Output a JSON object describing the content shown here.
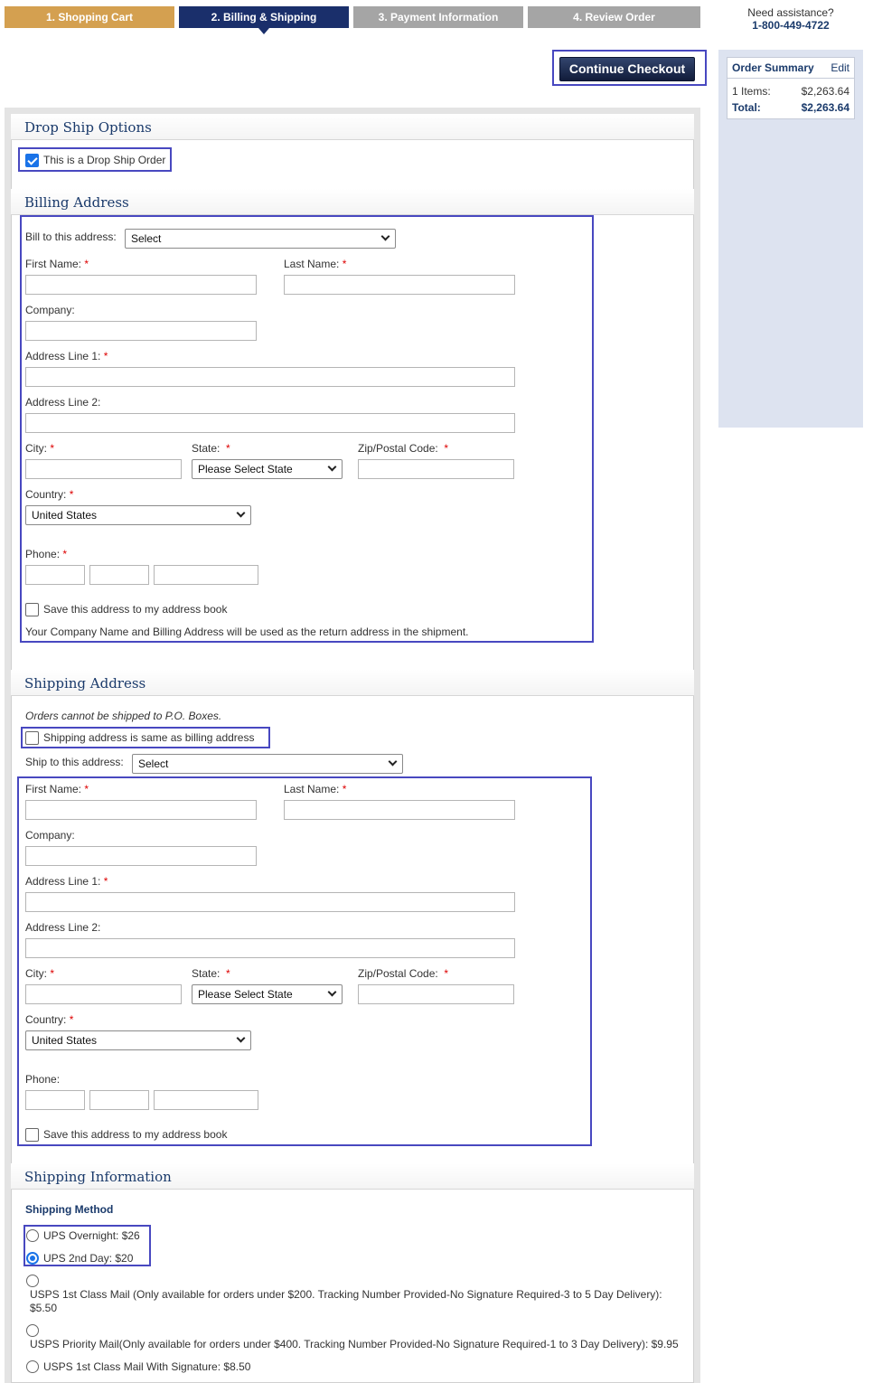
{
  "steps": [
    "1. Shopping Cart",
    "2. Billing & Shipping",
    "3. Payment Information",
    "4. Review Order"
  ],
  "assistance": {
    "label": "Need assistance?",
    "phone": "1-800-449-4722"
  },
  "continue_label": "Continue Checkout",
  "order_summary": {
    "title": "Order Summary",
    "edit": "Edit",
    "items_label": "1 Items:",
    "items_value": "$2,263.64",
    "total_label": "Total:",
    "total_value": "$2,263.64"
  },
  "drop_ship": {
    "heading": "Drop Ship Options",
    "checkbox_label": "This is a Drop Ship Order",
    "checked": true
  },
  "billing": {
    "heading": "Billing Address",
    "bill_to_label": "Bill to this address:",
    "bill_to_value": "Select",
    "first_name": "First Name:",
    "last_name": "Last Name:",
    "company": "Company:",
    "address1": "Address Line 1:",
    "address2": "Address Line 2:",
    "city": "City:",
    "state": "State:",
    "state_value": "Please Select State",
    "zip": "Zip/Postal Code:",
    "country": "Country:",
    "country_value": "United States",
    "phone": "Phone:",
    "save_label": "Save this address to my address book",
    "return_note": "Your Company Name and Billing Address will be used as the return address in the shipment.",
    "required_mark": "*"
  },
  "shipping": {
    "heading": "Shipping Address",
    "po_note": "Orders cannot be shipped to P.O. Boxes.",
    "same_label": "Shipping address is same as billing address",
    "ship_to_label": "Ship to this address:",
    "ship_to_value": "Select",
    "first_name": "First Name:",
    "last_name": "Last Name:",
    "company": "Company:",
    "address1": "Address Line 1:",
    "address2": "Address Line 2:",
    "city": "City:",
    "state": "State:",
    "state_value": "Please Select State",
    "zip": "Zip/Postal Code:",
    "country": "Country:",
    "country_value": "United States",
    "phone": "Phone:",
    "save_label": "Save this address to my address book",
    "required_mark": "*"
  },
  "shipping_info": {
    "heading": "Shipping Information",
    "method_label": "Shipping Method",
    "options": [
      {
        "label": "UPS Overnight: $26",
        "selected": false
      },
      {
        "label": "UPS 2nd Day: $20",
        "selected": true
      },
      {
        "label": "USPS 1st Class Mail (Only available for orders under $200. Tracking Number Provided-No Signature Required-3 to 5 Day Delivery): $5.50",
        "selected": false
      },
      {
        "label": "USPS Priority Mail(Only available for orders under $400. Tracking Number Provided-No Signature Required-1 to 3 Day Delivery): $9.95",
        "selected": false
      },
      {
        "label": "USPS 1st Class Mail With Signature: $8.50",
        "selected": false
      }
    ]
  }
}
